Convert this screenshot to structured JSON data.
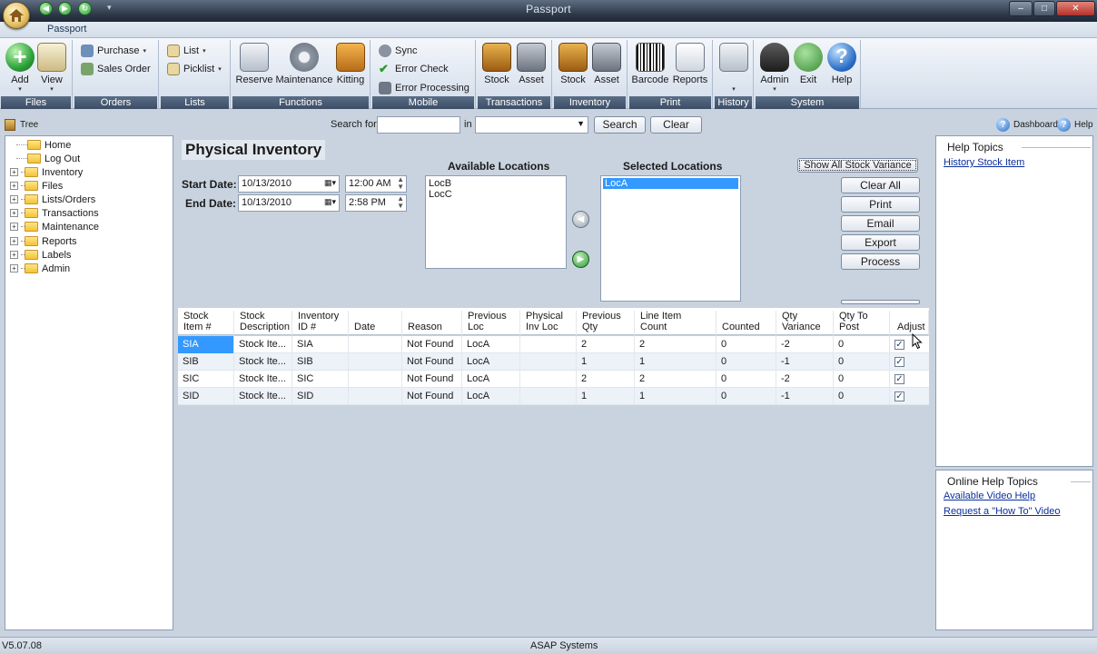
{
  "window": {
    "title": "Passport",
    "minimize": "–",
    "maximize": "□",
    "close": "✕"
  },
  "ribbon_tab": "Passport",
  "ribbon": {
    "groups": {
      "files": "Files",
      "orders": "Orders",
      "lists": "Lists",
      "functions": "Functions",
      "mobile": "Mobile",
      "transactions": "Transactions",
      "inventory": "Inventory",
      "print": "Print",
      "history": "History",
      "system": "System"
    },
    "add": "Add",
    "view": "View",
    "purchase": "Purchase",
    "sales_order": "Sales Order",
    "list": "List",
    "picklist": "Picklist",
    "reserve": "Reserve",
    "maintenance": "Maintenance",
    "kitting": "Kitting",
    "sync": "Sync",
    "error_check": "Error Check",
    "error_processing": "Error Processing",
    "stock_tx": "Stock",
    "asset_tx": "Asset",
    "stock_inv": "Stock",
    "asset_inv": "Asset",
    "barcode": "Barcode",
    "reports": "Reports",
    "admin": "Admin",
    "exit": "Exit",
    "help": "Help"
  },
  "toolbar": {
    "tree_label": "Tree",
    "search_for": "Search for",
    "in": "in",
    "search_btn": "Search",
    "clear_btn": "Clear",
    "dashboard": "Dashboard",
    "help": "Help"
  },
  "tree": {
    "items": [
      "Home",
      "Log Out",
      "Inventory",
      "Files",
      "Lists/Orders",
      "Transactions",
      "Maintenance",
      "Reports",
      "Labels",
      "Admin"
    ]
  },
  "form": {
    "title": "Physical Inventory",
    "start_date_label": "Start Date:",
    "start_date": "10/13/2010",
    "start_time": "12:00 AM",
    "end_date_label": "End Date:",
    "end_date": "10/13/2010",
    "end_time": "2:58 PM",
    "available_label": "Available Locations",
    "available": [
      "LocB",
      "LocC"
    ],
    "selected_label": "Selected Locations",
    "selected": [
      "LocA"
    ],
    "show_all": "Show All Stock Variance",
    "buttons": {
      "clear_all": "Clear All",
      "print": "Print",
      "email": "Email",
      "export": "Export",
      "process": "Process"
    }
  },
  "grid": {
    "headers": [
      [
        "Stock",
        "Item #"
      ],
      [
        "Stock",
        "Description"
      ],
      [
        "Inventory",
        "ID #"
      ],
      [
        "",
        "Date"
      ],
      [
        "",
        "Reason"
      ],
      [
        "Previous",
        "Loc"
      ],
      [
        "Physical",
        "Inv Loc"
      ],
      [
        "Previous",
        "Qty"
      ],
      [
        "Line Item",
        "Count"
      ],
      [
        "",
        "Counted"
      ],
      [
        "Qty",
        "Variance"
      ],
      [
        "Qty To",
        "Post"
      ],
      [
        "",
        "Adjust"
      ]
    ],
    "rows": [
      [
        "SIA",
        "Stock Ite...",
        "SIA",
        "",
        "Not Found",
        "LocA",
        "",
        "2",
        "2",
        "0",
        "-2",
        "0",
        "✓"
      ],
      [
        "SIB",
        "Stock Ite...",
        "SIB",
        "",
        "Not Found",
        "LocA",
        "",
        "1",
        "1",
        "0",
        "-1",
        "0",
        "✓"
      ],
      [
        "SIC",
        "Stock Ite...",
        "SIC",
        "",
        "Not Found",
        "LocA",
        "",
        "2",
        "2",
        "0",
        "-2",
        "0",
        "✓"
      ],
      [
        "SID",
        "Stock Ite...",
        "SID",
        "",
        "Not Found",
        "LocA",
        "",
        "1",
        "1",
        "0",
        "-1",
        "0",
        "✓"
      ]
    ]
  },
  "help_panel": {
    "title": "Help Topics",
    "link": "History Stock Item"
  },
  "online_help": {
    "title": "Online Help Topics",
    "links": [
      "Available Video Help",
      "Request a \"How To\" Video"
    ]
  },
  "status": {
    "version": "V5.07.08",
    "company": "ASAP Systems"
  },
  "colors": {
    "ribbon_group_label": "#3c4d66",
    "selection": "#3399ff",
    "link": "#0a2f9e"
  }
}
